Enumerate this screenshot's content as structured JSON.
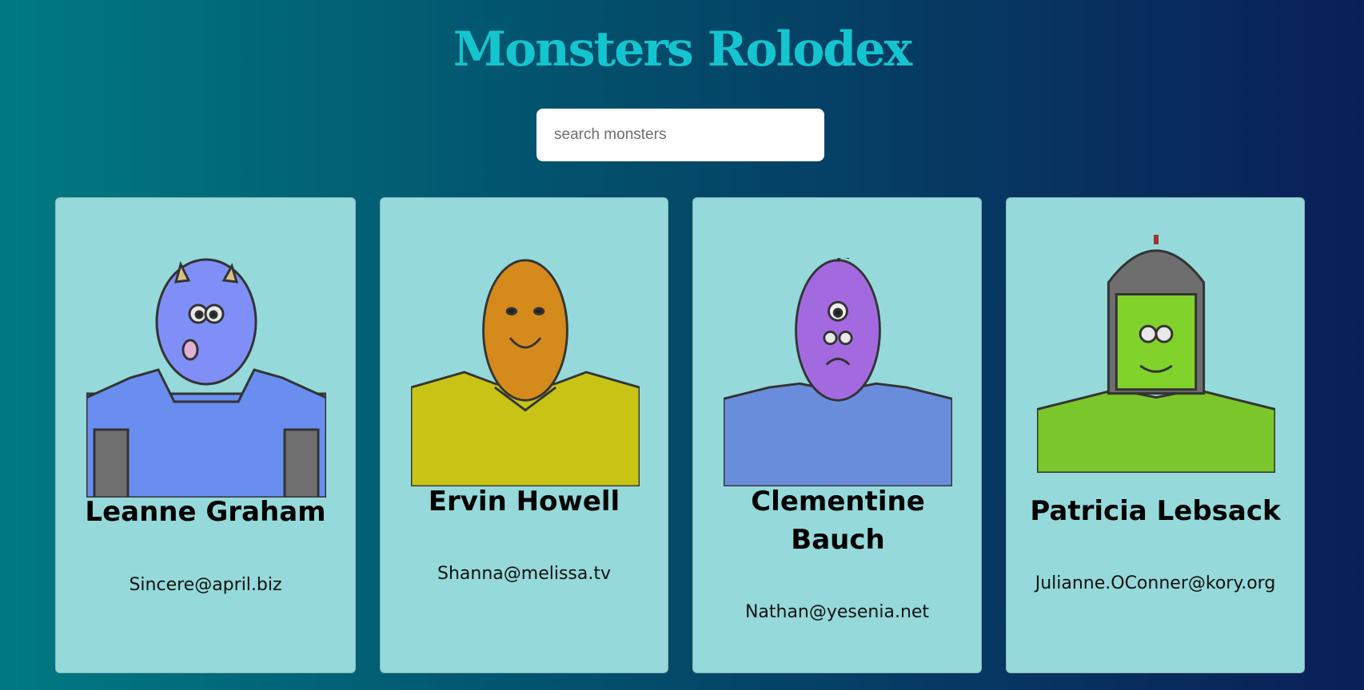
{
  "header": {
    "title": "Monsters Rolodex"
  },
  "search": {
    "placeholder": "search monsters",
    "value": ""
  },
  "monsters": [
    {
      "name": "Leanne Graham",
      "email": "Sincere@april.biz"
    },
    {
      "name": "Ervin Howell",
      "email": "Shanna@melissa.tv"
    },
    {
      "name": "Clementine Bauch",
      "email": "Nathan@yesenia.net"
    },
    {
      "name": "Patricia Lebsack",
      "email": "Julianne.OConner@kory.org"
    }
  ]
}
